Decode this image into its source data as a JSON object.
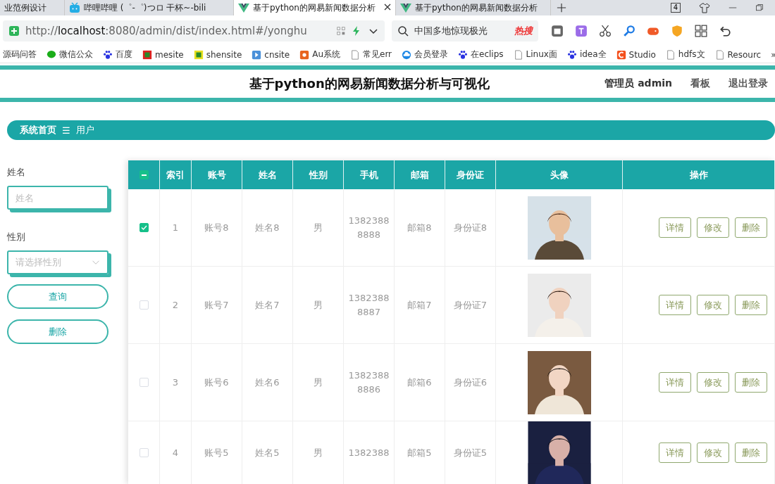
{
  "browser": {
    "tabs": [
      {
        "title": "业范例设计",
        "kind": "none",
        "selected": false
      },
      {
        "title": "哔哩哔哩 (゜-゜)つロ 干杯~-bili",
        "kind": "tv",
        "selected": false
      },
      {
        "title": "基于python的网易新闻数据分析",
        "kind": "v",
        "selected": true
      },
      {
        "title": "基于python的网易新闻数据分析",
        "kind": "v",
        "selected": false
      }
    ],
    "tab_count": "4",
    "url_scheme": "http://",
    "url_host": "localhost",
    "url_rest": ":8080/admin/dist/index.html#/yonghu",
    "search": {
      "placeholder": "中国多地惊现极光",
      "badge": "热搜"
    },
    "bookmarks": [
      {
        "label": "源码问答",
        "kind": "none"
      },
      {
        "label": "微信公众",
        "kind": "chat",
        "color": "#1aad19"
      },
      {
        "label": "百度",
        "kind": "paw",
        "color": "#2932e1"
      },
      {
        "label": "mesite",
        "kind": "square",
        "color": "#e02020"
      },
      {
        "label": "shensite",
        "kind": "square",
        "color": "#e8e020"
      },
      {
        "label": "cnsite",
        "kind": "play",
        "color": "#4a90d9"
      },
      {
        "label": "Au系统",
        "kind": "grid",
        "color": "#e8641e"
      },
      {
        "label": "常见err",
        "kind": "doc"
      },
      {
        "label": "会员登录",
        "kind": "cloud",
        "color": "#1e88e5"
      },
      {
        "label": "在eclips",
        "kind": "paw",
        "color": "#2932e1"
      },
      {
        "label": "Linux面",
        "kind": "doc"
      },
      {
        "label": "idea全",
        "kind": "paw",
        "color": "#2932e1"
      },
      {
        "label": "Studio",
        "kind": "letter",
        "color": "#f4511e"
      },
      {
        "label": "hdfs文",
        "kind": "doc"
      },
      {
        "label": "Resourc",
        "kind": "doc"
      }
    ],
    "more": "»"
  },
  "header": {
    "title": "基于python的网易新闻数据分析与可视化",
    "links": [
      "管理员 admin",
      "看板",
      "退出登录"
    ]
  },
  "breadcrumb": {
    "home": "系统首页",
    "separator": "☰",
    "current": "用户"
  },
  "filters": {
    "fields": [
      {
        "label": "姓名",
        "placeholder": "姓名",
        "kind": "input"
      },
      {
        "label": "性别",
        "placeholder": "请选择性别",
        "kind": "select"
      }
    ],
    "buttons": [
      "查询",
      "删除"
    ]
  },
  "table": {
    "indeterminate": true,
    "columns": [
      "索引",
      "账号",
      "姓名",
      "性别",
      "手机",
      "邮箱",
      "身份证",
      "头像",
      "操作"
    ],
    "rows": [
      {
        "selected": true,
        "index": "1",
        "account": "账号8",
        "name": "姓名8",
        "gender": "男",
        "phone": [
          "1382388",
          "8888"
        ],
        "email": "邮箱8",
        "id_card": "身份证8",
        "avatar": {
          "kind": "picture"
        },
        "actions": [
          "详情",
          "修改",
          "删除"
        ]
      },
      {
        "selected": false,
        "index": "2",
        "account": "账号7",
        "name": "姓名7",
        "gender": "男",
        "phone": [
          "1382388",
          "8887"
        ],
        "email": "邮箱7",
        "id_card": "身份证7",
        "avatar": {
          "kind": "picture"
        },
        "actions": [
          "详情",
          "修改",
          "删除"
        ]
      },
      {
        "selected": false,
        "index": "3",
        "account": "账号6",
        "name": "姓名6",
        "gender": "男",
        "phone": [
          "1382388",
          "8886"
        ],
        "email": "邮箱6",
        "id_card": "身份证6",
        "avatar": {
          "kind": "picture"
        },
        "actions": [
          "详情",
          "修改",
          "删除"
        ]
      },
      {
        "selected": false,
        "index": "4",
        "account": "账号5",
        "name": "姓名5",
        "gender": "男",
        "phone": [
          "1382388"
        ],
        "email": "邮箱5",
        "id_card": "身份证5",
        "avatar": {
          "kind": "picture"
        },
        "actions": [
          "详情",
          "修改",
          "删除"
        ]
      }
    ]
  }
}
